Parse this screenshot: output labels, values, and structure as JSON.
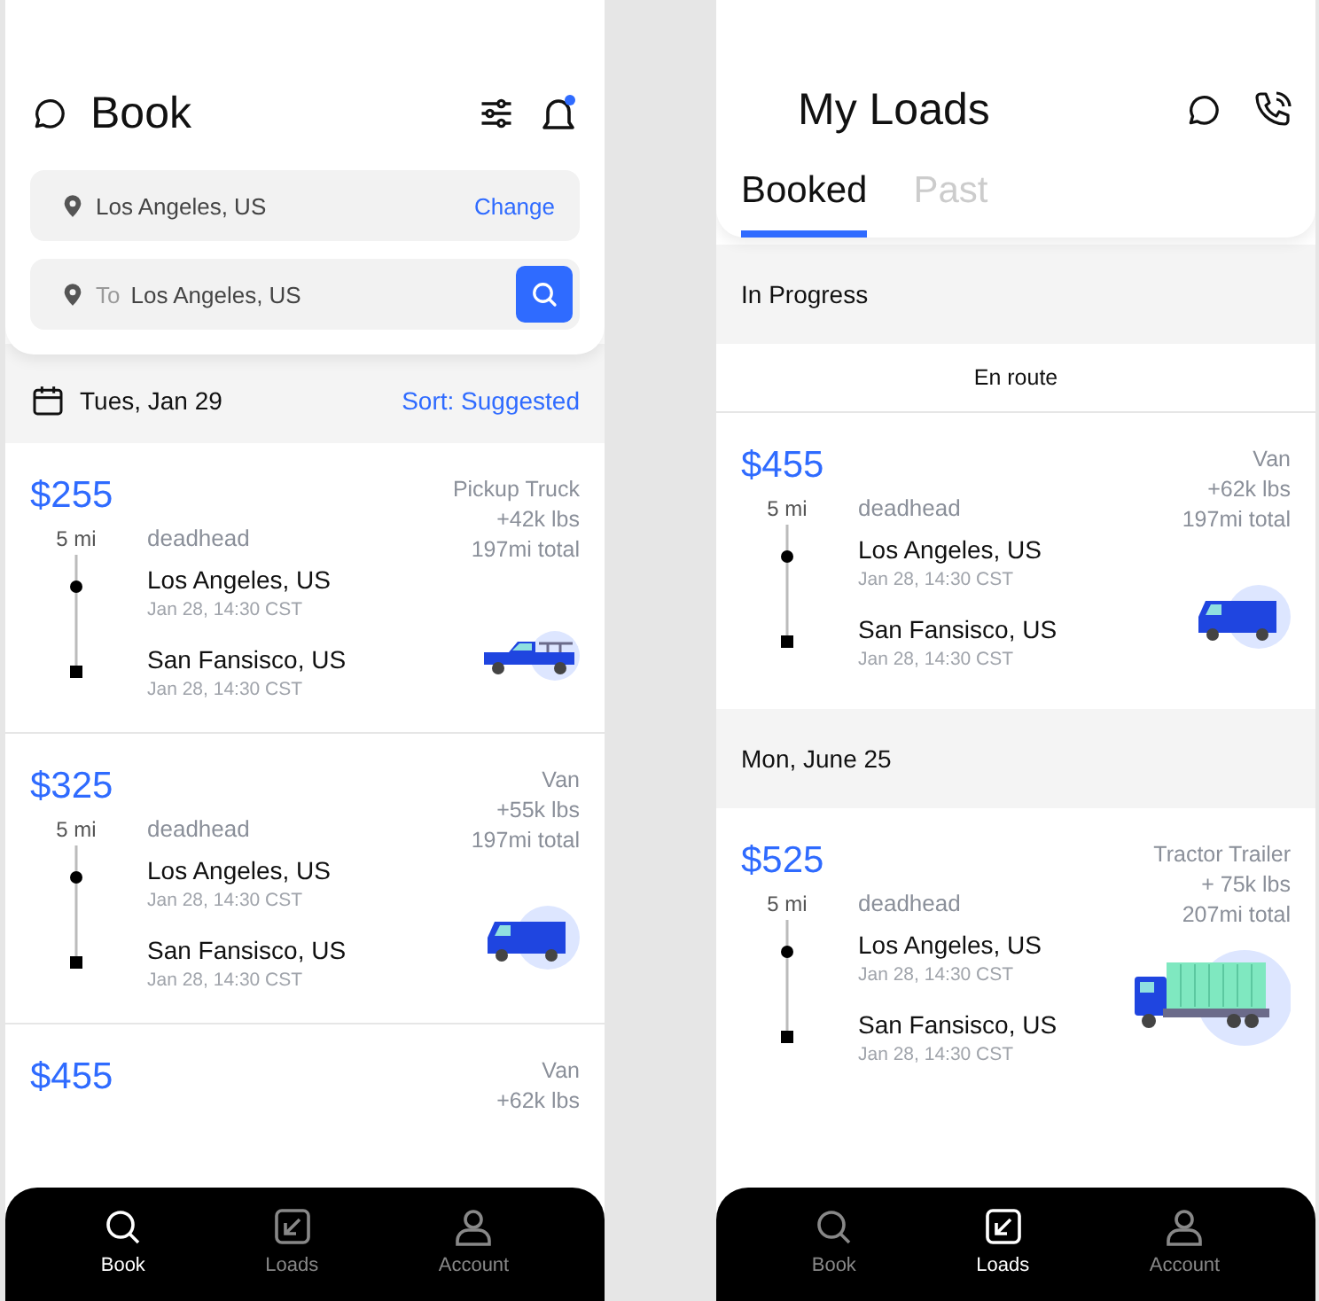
{
  "book_screen": {
    "title": "Book",
    "notifications_unread": true,
    "origin": {
      "value": "Los Angeles, US",
      "action": "Change"
    },
    "destination": {
      "label": "To",
      "value": "Los Angeles, US"
    },
    "date": "Tues, Jan 29",
    "sort": "Sort: Suggested",
    "loads": [
      {
        "price": "$255",
        "vehicle": "Pickup Truck",
        "weight": "+42k lbs",
        "total": "197mi total",
        "deadhead_distance": "5 mi",
        "deadhead_label": "deadhead",
        "kind": "pickup",
        "stops": [
          {
            "kind": "pickup",
            "city": "Los Angeles, US",
            "time": "Jan 28, 14:30 CST"
          },
          {
            "kind": "dropoff",
            "city": "San Fansisco, US",
            "time": "Jan 28, 14:30 CST"
          }
        ]
      },
      {
        "price": "$325",
        "vehicle": "Van",
        "weight": "+55k lbs",
        "total": "197mi total",
        "deadhead_distance": "5 mi",
        "deadhead_label": "deadhead",
        "kind": "van",
        "stops": [
          {
            "kind": "pickup",
            "city": "Los Angeles, US",
            "time": "Jan 28, 14:30 CST"
          },
          {
            "kind": "dropoff",
            "city": "San Fansisco, US",
            "time": "Jan 28, 14:30 CST"
          }
        ]
      },
      {
        "price": "$455",
        "vehicle": "Van",
        "weight": "+62k lbs"
      }
    ],
    "nav": [
      {
        "label": "Book",
        "selected": true
      },
      {
        "label": "Loads",
        "selected": false
      },
      {
        "label": "Account",
        "selected": false
      }
    ]
  },
  "loads_screen": {
    "title": "My Loads",
    "tabs": [
      {
        "label": "Booked",
        "selected": true
      },
      {
        "label": "Past",
        "selected": false
      }
    ],
    "sections": [
      {
        "title": "In Progress",
        "status": "En route",
        "loads": [
          {
            "price": "$455",
            "vehicle": "Van",
            "weight": "+62k lbs",
            "total": "197mi total",
            "deadhead_distance": "5 mi",
            "deadhead_label": "deadhead",
            "kind": "van",
            "stops": [
              {
                "kind": "pickup",
                "city": "Los Angeles, US",
                "time": "Jan 28, 14:30 CST"
              },
              {
                "kind": "dropoff",
                "city": "San Fansisco, US",
                "time": "Jan 28, 14:30 CST"
              }
            ]
          }
        ]
      },
      {
        "title": "Mon, June 25",
        "loads": [
          {
            "price": "$525",
            "vehicle": "Tractor Trailer",
            "weight": "+ 75k lbs",
            "total": "207mi total",
            "deadhead_distance": "5 mi",
            "deadhead_label": "deadhead",
            "kind": "trailer",
            "stops": [
              {
                "kind": "pickup",
                "city": "Los Angeles, US",
                "time": "Jan 28, 14:30 CST"
              },
              {
                "kind": "dropoff",
                "city": "San Fansisco, US",
                "time": "Jan 28, 14:30 CST"
              }
            ]
          }
        ]
      }
    ],
    "nav": [
      {
        "label": "Book",
        "selected": false
      },
      {
        "label": "Loads",
        "selected": true
      },
      {
        "label": "Account",
        "selected": false
      }
    ]
  }
}
